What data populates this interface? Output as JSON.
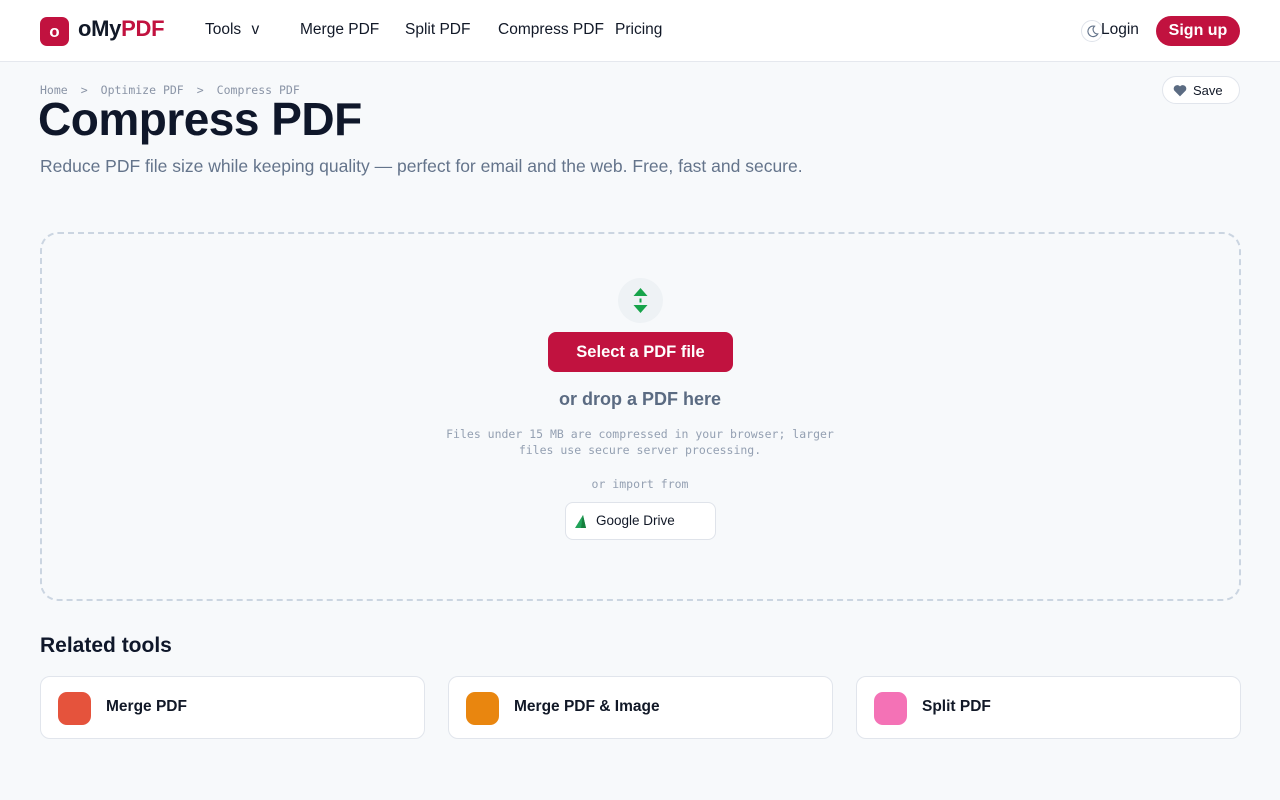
{
  "brand": {
    "logo_letter": "o",
    "name_part1": "oMy",
    "name_part2": "PDF",
    "accent_color": "#c1123f"
  },
  "nav": {
    "tools_label": "Tools",
    "tools_chevron": "v",
    "items": [
      "Merge PDF",
      "Split PDF",
      "Compress PDF",
      "Pricing"
    ],
    "login_label": "Login",
    "signup_label": "Sign up",
    "theme_icon": "moon-icon"
  },
  "breadcrumb": {
    "items": [
      "Home",
      "Optimize PDF",
      "Compress PDF"
    ],
    "separator": ">"
  },
  "save_label": "Save",
  "page": {
    "title": "Compress PDF",
    "subtitle": "Reduce PDF file size while keeping quality — perfect for email and the web. Free, fast and secure."
  },
  "dropzone": {
    "icon": "compress-arrows-icon",
    "select_label": "Select a PDF file",
    "drop_text": "or drop a PDF here",
    "hint": "Files under 15 MB are compressed in your browser; larger files use secure server processing.",
    "import_label": "or import from",
    "gdrive_label": "Google Drive"
  },
  "related": {
    "title": "Related tools",
    "tools": [
      {
        "name": "Merge PDF",
        "color": "#e5533c"
      },
      {
        "name": "Merge PDF & Image",
        "color": "#e9860f"
      },
      {
        "name": "Split PDF",
        "color": "#f472b6"
      }
    ]
  }
}
